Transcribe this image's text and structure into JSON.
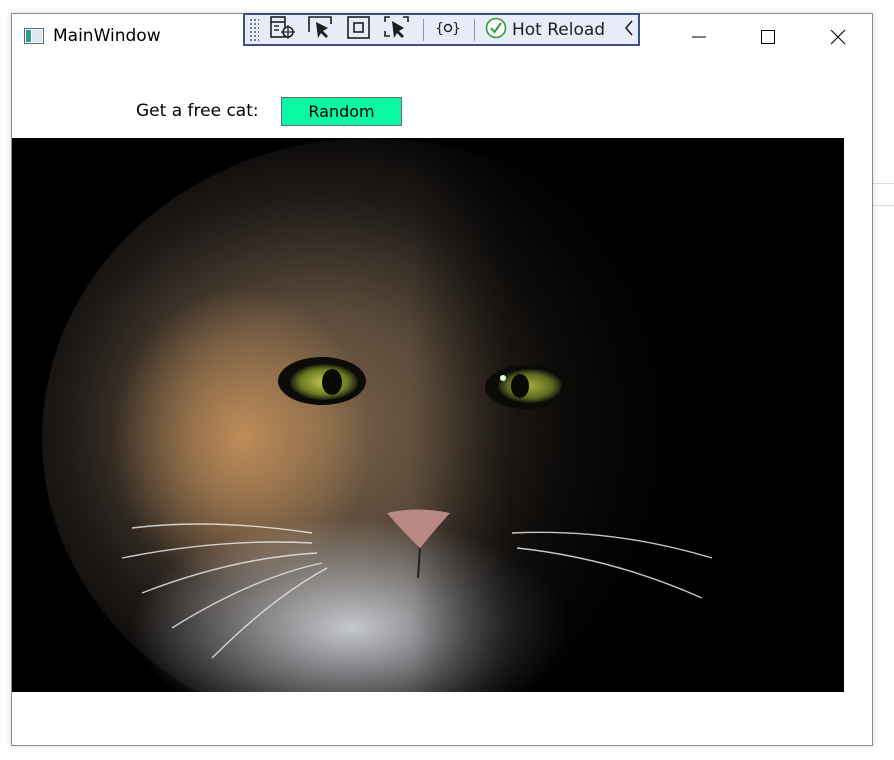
{
  "window": {
    "title": "MainWindow"
  },
  "hot_reload_toolbar": {
    "hot_reload_label": "Hot Reload"
  },
  "content": {
    "prompt_label": "Get a free cat:",
    "random_button_label": "Random"
  },
  "colors": {
    "random_button_bg": "#0af7a3",
    "toolbar_bg": "#e8ecf9",
    "toolbar_border": "#3b4f8c",
    "check_green": "#2e9e3a"
  },
  "icons": {
    "app": "app-window-icon",
    "minimize": "minimize-icon",
    "maximize": "maximize-icon",
    "close": "close-icon",
    "toolbar": [
      "live-visual-tree-icon",
      "select-element-icon",
      "display-layout-adorners-icon",
      "track-focus-icon",
      "binding-failures-icon",
      "hot-reload-check-icon",
      "collapse-chevron-icon"
    ]
  }
}
